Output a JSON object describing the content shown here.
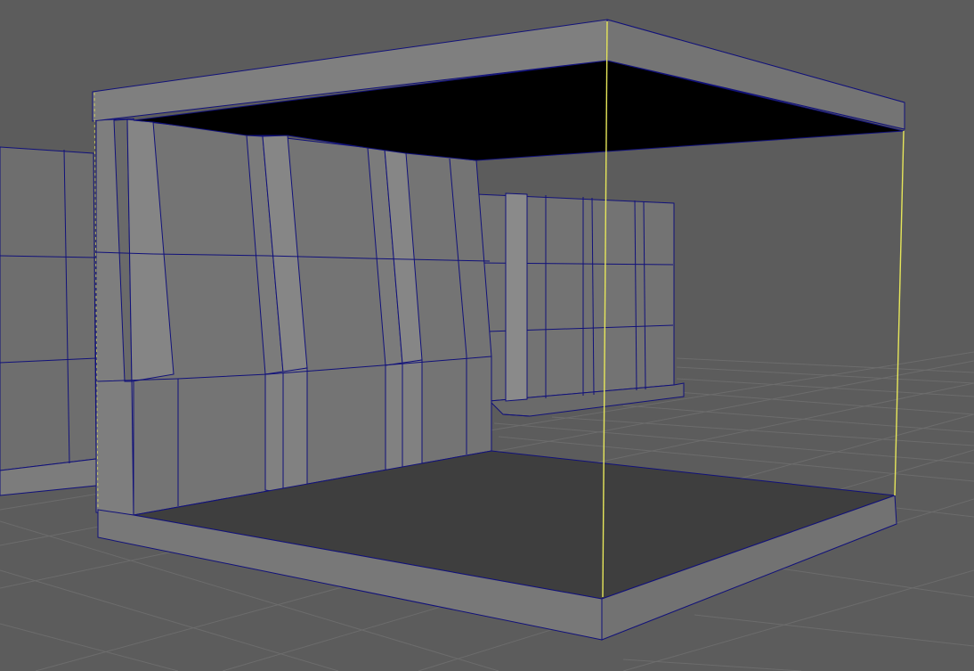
{
  "viewport": {
    "background_color": "#5c5c5c",
    "grid_color": "#6c6c6c",
    "wireframe_color": "#11117a",
    "selection_color": "#e6e65a",
    "mesh_light": "#7f7f7f",
    "mesh_mid": "#727272",
    "mesh_dark": "#5f5f5f",
    "floor_inner": "#3e3e3e",
    "ceiling_inner": "#000000"
  },
  "scene_objects": [
    {
      "name": "room-floor-slab",
      "selected": false
    },
    {
      "name": "room-ceiling-slab",
      "selected": false
    },
    {
      "name": "room-back-wall",
      "selected": false
    },
    {
      "name": "background-wall-block",
      "selected": false
    },
    {
      "name": "left-wall-block",
      "selected": false
    },
    {
      "name": "selected-edge-front",
      "selected": true
    },
    {
      "name": "selected-edge-right",
      "selected": true
    }
  ]
}
